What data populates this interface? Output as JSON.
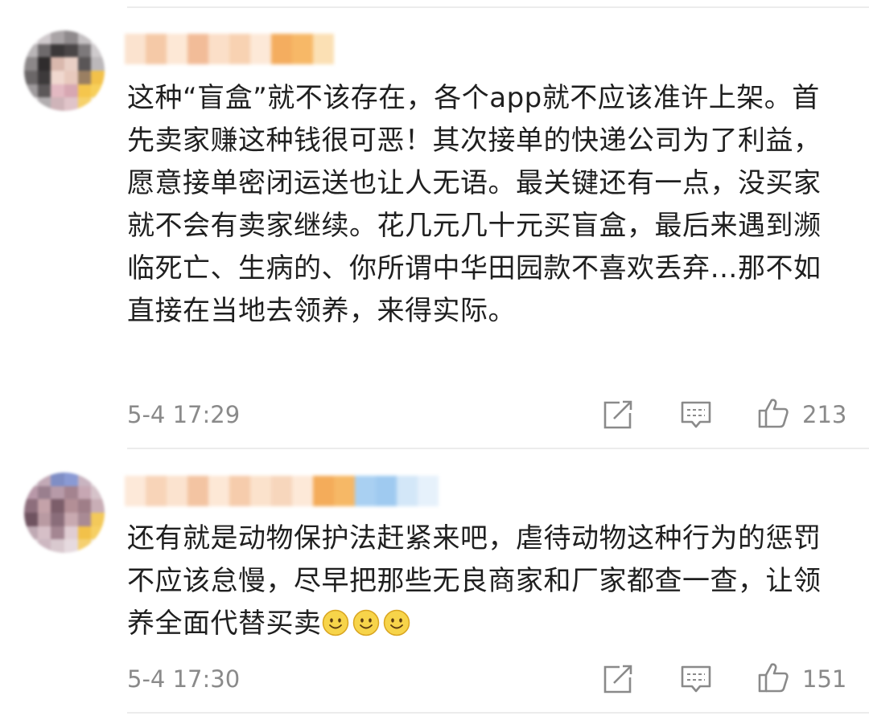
{
  "comments": [
    {
      "text": "这种“盲盒”就不该存在，各个app就不应该准许上架。首先卖家赚这种钱很可恶！其次接单的快递公司为了利益，愿意接单密闭运送也让人无语。最关键还有一点，没买家就不会有卖家继续。花几元几十元买盲盒，最后来遇到濒临死亡、生病的、你所谓中华田园款不喜欢丢弃…那不如直接在当地去领养，来得实际。",
      "time": "5-4 17:29",
      "likes": "213"
    },
    {
      "text": "还有就是动物保护法赶紧来吧，虐待动物这种行为的惩罚不应该怠慢，尽早把那些无良商家和厂家都查一查，让领养全面代替买卖",
      "emoji_count": 3,
      "emoji_icon": "smile-emoji-icon",
      "time": "5-4 17:30",
      "likes": "151"
    }
  ],
  "icons": {
    "share": "share-icon",
    "reply": "comment-icon",
    "like": "thumbs-up-icon"
  },
  "colors": {
    "text": "#1f1f1f",
    "meta": "#8a8a8a",
    "divider": "#ececec",
    "emoji": "#f5c518"
  }
}
